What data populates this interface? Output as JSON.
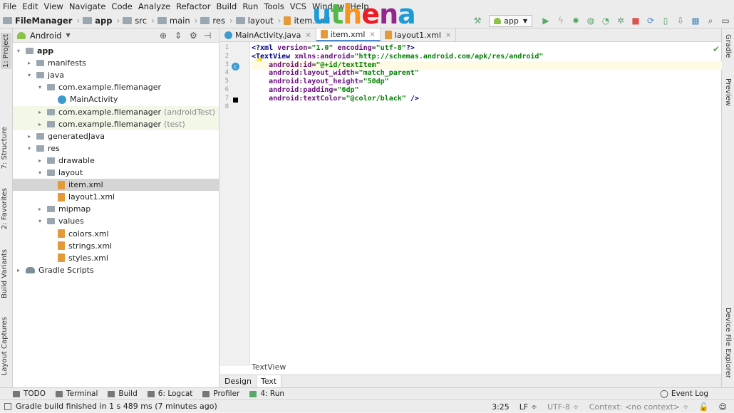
{
  "menu": [
    "File",
    "Edit",
    "View",
    "Navigate",
    "Code",
    "Analyze",
    "Refactor",
    "Build",
    "Run",
    "Tools",
    "VCS",
    "Window",
    "Help"
  ],
  "watermark": {
    "u": "u",
    "t": "t",
    "h": "h",
    "e": "e",
    "n": "n",
    "a": "a"
  },
  "breadcrumb": [
    "FileManager",
    "app",
    "src",
    "main",
    "res",
    "layout",
    "item.xml"
  ],
  "run_config": "app",
  "left_tabs": [
    "1: Project",
    "7: Structure",
    "2: Favorites",
    "Build Variants",
    "Layout Captures"
  ],
  "right_tabs": [
    "Gradle",
    "Preview",
    "Device File Explorer"
  ],
  "project_view": "Android",
  "tree": [
    {
      "label": "app",
      "suffix": "",
      "indent": 0,
      "icon": "folder",
      "arrow": "▾",
      "bold": true
    },
    {
      "label": "manifests",
      "suffix": "",
      "indent": 1,
      "icon": "folder",
      "arrow": "▸"
    },
    {
      "label": "java",
      "suffix": "",
      "indent": 1,
      "icon": "folder",
      "arrow": "▾"
    },
    {
      "label": "com.example.filemanager",
      "suffix": "",
      "indent": 2,
      "icon": "folder",
      "arrow": "▾"
    },
    {
      "label": "MainActivity",
      "suffix": "",
      "indent": 3,
      "icon": "class",
      "arrow": ""
    },
    {
      "label": "com.example.filemanager",
      "suffix": "(androidTest)",
      "indent": 2,
      "icon": "folder",
      "arrow": "▸",
      "green": true
    },
    {
      "label": "com.example.filemanager",
      "suffix": "(test)",
      "indent": 2,
      "icon": "folder",
      "arrow": "▸",
      "green": true
    },
    {
      "label": "generatedJava",
      "suffix": "",
      "indent": 1,
      "icon": "folder",
      "arrow": "▸"
    },
    {
      "label": "res",
      "suffix": "",
      "indent": 1,
      "icon": "folder",
      "arrow": "▾"
    },
    {
      "label": "drawable",
      "suffix": "",
      "indent": 2,
      "icon": "folder",
      "arrow": "▸"
    },
    {
      "label": "layout",
      "suffix": "",
      "indent": 2,
      "icon": "folder",
      "arrow": "▾"
    },
    {
      "label": "item.xml",
      "suffix": "",
      "indent": 3,
      "icon": "xml",
      "arrow": "",
      "selected": true
    },
    {
      "label": "layout1.xml",
      "suffix": "",
      "indent": 3,
      "icon": "xml",
      "arrow": ""
    },
    {
      "label": "mipmap",
      "suffix": "",
      "indent": 2,
      "icon": "folder",
      "arrow": "▸"
    },
    {
      "label": "values",
      "suffix": "",
      "indent": 2,
      "icon": "folder",
      "arrow": "▾"
    },
    {
      "label": "colors.xml",
      "suffix": "",
      "indent": 3,
      "icon": "xml",
      "arrow": ""
    },
    {
      "label": "strings.xml",
      "suffix": "",
      "indent": 3,
      "icon": "xml",
      "arrow": ""
    },
    {
      "label": "styles.xml",
      "suffix": "",
      "indent": 3,
      "icon": "xml",
      "arrow": ""
    },
    {
      "label": "Gradle Scripts",
      "suffix": "",
      "indent": 0,
      "icon": "gradle",
      "arrow": "▸"
    }
  ],
  "editor_tabs": [
    {
      "label": "MainActivity.java",
      "icon": "class",
      "active": false
    },
    {
      "label": "item.xml",
      "icon": "xml",
      "active": true
    },
    {
      "label": "layout1.xml",
      "icon": "xml",
      "active": false
    }
  ],
  "code_lines": [
    {
      "n": "1",
      "parts": [
        [
          "kw",
          "<?xml "
        ],
        [
          "attr",
          "version"
        ],
        [
          "pl",
          "="
        ],
        [
          "str",
          "\"1.0\""
        ],
        [
          "pl",
          " "
        ],
        [
          "attr",
          "encoding"
        ],
        [
          "pl",
          "="
        ],
        [
          "str",
          "\"utf-8\""
        ],
        [
          "kw",
          "?>"
        ]
      ]
    },
    {
      "n": "2",
      "parts": [
        [
          "kw",
          "<TextView "
        ],
        [
          "attr",
          "xmlns:android"
        ],
        [
          "pl",
          "="
        ],
        [
          "str",
          "\"http://schemas.android.com/apk/res/android\""
        ]
      ]
    },
    {
      "n": "3",
      "parts": [
        [
          "pl",
          "    "
        ],
        [
          "attr",
          "android:id"
        ],
        [
          "pl",
          "="
        ],
        [
          "str",
          "\"@+id/textItem\""
        ]
      ],
      "current": true
    },
    {
      "n": "4",
      "parts": [
        [
          "pl",
          "    "
        ],
        [
          "attr",
          "android:layout_width"
        ],
        [
          "pl",
          "="
        ],
        [
          "str",
          "\"match_parent\""
        ]
      ]
    },
    {
      "n": "5",
      "parts": [
        [
          "pl",
          "    "
        ],
        [
          "attr",
          "android:layout_height"
        ],
        [
          "pl",
          "="
        ],
        [
          "str",
          "\"50dp\""
        ]
      ]
    },
    {
      "n": "6",
      "parts": [
        [
          "pl",
          "    "
        ],
        [
          "attr",
          "android:padding"
        ],
        [
          "pl",
          "="
        ],
        [
          "str",
          "\"6dp\""
        ]
      ]
    },
    {
      "n": "7",
      "parts": [
        [
          "pl",
          "    "
        ],
        [
          "attr",
          "android:textColor"
        ],
        [
          "pl",
          "="
        ],
        [
          "str",
          "\"@color/black\""
        ],
        [
          "pl",
          " "
        ],
        [
          "kw",
          "/>"
        ]
      ]
    },
    {
      "n": "8",
      "parts": []
    }
  ],
  "editor_breadcrumb": "TextView",
  "mode_tabs": [
    {
      "label": "Design",
      "active": false
    },
    {
      "label": "Text",
      "active": true
    }
  ],
  "bottom_tools": [
    "TODO",
    "Terminal",
    "Build",
    "6: Logcat",
    "Profiler",
    "4: Run"
  ],
  "event_log": "Event Log",
  "status": {
    "message": "Gradle build finished in 1 s 489 ms (7 minutes ago)",
    "position": "3:25",
    "line_sep": "LF ÷",
    "encoding": "UTF-8 ÷",
    "context": "Context: <no context> ÷"
  }
}
